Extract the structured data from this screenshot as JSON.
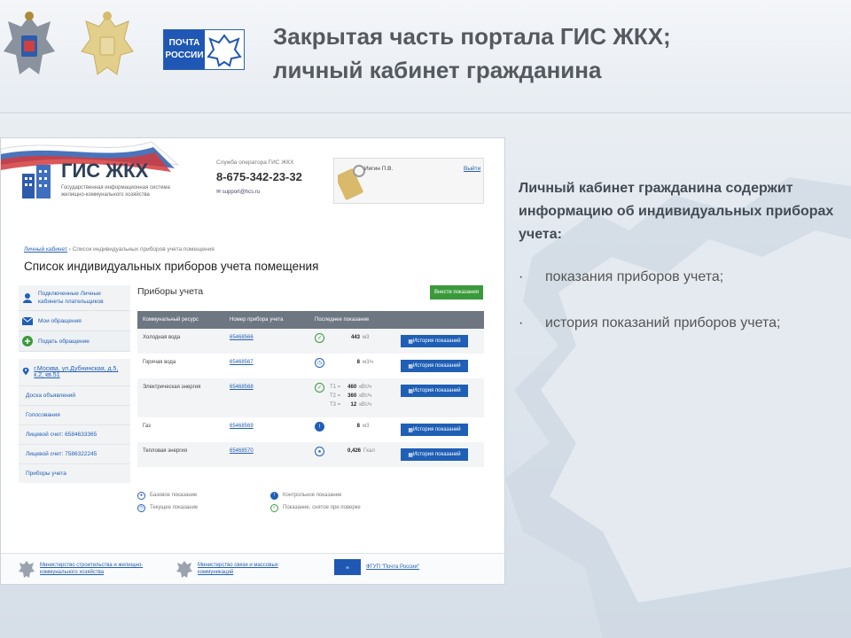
{
  "slide": {
    "title_line1": "Закрытая часть портала ГИС ЖКХ;",
    "title_line2": "личный кабинет гражданина",
    "pochta_logo_line1": "ПОЧТА",
    "pochta_logo_line2": "РОССИИ"
  },
  "portal": {
    "logo_title": "ГИС ЖКХ",
    "logo_subtitle": "Государственная информационная система жилищно-коммунального хозяйства",
    "support_label": "Служба оператора ГИС ЖКХ",
    "support_phone": "8-675-342-23-32",
    "support_email": "support@hcs.ru",
    "user_name": "Иигин П.В.",
    "exit_label": "Выйти",
    "breadcrumb": {
      "root": "Личный кабинет",
      "current": "Список индивидуальных приборов учета помещения"
    },
    "page_title": "Список индивидуальных приборов учета помещения",
    "sidebar": {
      "connected": "Подключенные Личные кабинеты плательщиков",
      "my_requests": "Мои обращения",
      "new_request": "Подать обращение",
      "address": "г.Москва, ул.Дубнинская, д.5, к.2, кв.51",
      "links": [
        "Доска объявлений",
        "Голосования",
        "Лицевой счет: 6584633365",
        "Лицевой счет: 7586322245",
        "Приборы учета"
      ]
    },
    "devices_title": "Приборы учета",
    "add_button": "Внести показания",
    "table_headers": [
      "Коммунальный ресурс",
      "Номер прибора учета",
      "Последнее показание",
      ""
    ],
    "meters": [
      {
        "resource": "Холодная вода",
        "number": "65468566",
        "status": "controlled",
        "readings": [
          {
            "label": "",
            "value": "443",
            "unit": "м3"
          }
        ]
      },
      {
        "resource": "Горячая вода",
        "number": "65468567",
        "status": "current",
        "readings": [
          {
            "label": "",
            "value": "8",
            "unit": "м3/ч"
          }
        ]
      },
      {
        "resource": "Электрическая энергия",
        "number": "65468568",
        "status": "controlled",
        "readings": [
          {
            "label": "T1 =",
            "value": "460",
            "unit": "кВт/ч"
          },
          {
            "label": "T2 =",
            "value": "360",
            "unit": "кВт/ч"
          },
          {
            "label": "T3 =",
            "value": "12",
            "unit": "кВт/ч"
          }
        ]
      },
      {
        "resource": "Газ",
        "number": "65468569",
        "status": "control",
        "readings": [
          {
            "label": "",
            "value": "8",
            "unit": "м3"
          }
        ]
      },
      {
        "resource": "Тепловая энергия",
        "number": "65468570",
        "status": "base",
        "readings": [
          {
            "label": "",
            "value": "0,426",
            "unit": "Гкал"
          }
        ]
      }
    ],
    "history_button": "История показаний",
    "legend": {
      "base": "Базовое показание",
      "current": "Текущее показание",
      "control": "Контрольное показание",
      "controlled": "Показание, снятое при поверке"
    },
    "footer": {
      "ministry1": "Министерство строительства и жилищно-коммунального хозяйства",
      "ministry2": "Министерство связи и массовых коммуникаций",
      "pochta": "ФГУП \"Почта России\""
    }
  },
  "description": {
    "text": "Личный кабинет гражданина содержит информацию об индивидуальных приборах учета:",
    "bullets": [
      "показания приборов учета;",
      "история показаний приборов учета;"
    ]
  },
  "colors": {
    "accent_blue": "#1f5fb5",
    "accent_green": "#3a9a3a",
    "table_header": "#6d7681",
    "title_gray": "#555a61"
  }
}
